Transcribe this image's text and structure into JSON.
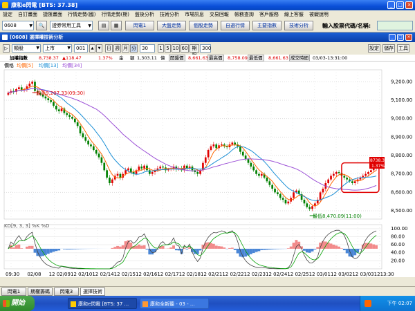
{
  "window": {
    "title": "康和e閃電 [BTS: 37.38]",
    "min": "_",
    "max": "□",
    "close": "×"
  },
  "menu": [
    "設定",
    "自訂畫面",
    "捷匯畫面",
    "行情走勢(國)",
    "行情走勢(期)",
    "盤後分析",
    "技術分析",
    "市場訊息",
    "交易回報",
    "帳務查詢",
    "客戶服務",
    "線上客服",
    "被蝦說明"
  ],
  "toolbar": {
    "code": "0608",
    "group": "證券常用工具",
    "buttons": [
      "閃電1",
      "大盤走勢",
      "個股走勢",
      "自選行情",
      "主要指數",
      "技術分析"
    ],
    "input_label": "輸入股票代碼/名稱:",
    "input_value": ""
  },
  "chart_window": {
    "title": "[0608] 選擇權技術分析",
    "btn_settings": "設定",
    "btn_save": "儲存",
    "btn_tool": "工具"
  },
  "subtool": {
    "category": "類股",
    "market": "上市",
    "code": "001",
    "period_buttons": [
      "日",
      "週",
      "月",
      "分"
    ],
    "minutes": "30",
    "count_buttons": [
      "1",
      "5",
      "10",
      "60",
      "期限"
    ],
    "bars": "300"
  },
  "info": {
    "name": "加權指數",
    "price": "8,738.37",
    "change": "▲118.47",
    "pct": "1.37%",
    "amount_label": "金",
    "amount": "額",
    "amount_value": "1,303.11",
    "unit": "億",
    "open_label": "開盤價",
    "open": "8,661.63",
    "high_label": "最高價",
    "high": "8,758.09",
    "low_label": "最低價",
    "low": "8,661.63",
    "time_label": "成交時間",
    "time": "03/03-13:31:00"
  },
  "price_legend": {
    "label": "價格",
    "ma1": "均價[5]",
    "ma2": "均價[13]",
    "ma3": "均價[34]"
  },
  "kd_legend": "KD[9, 3, 3] %K %D",
  "annotations": {
    "high": "最高9,207.33(09:30)",
    "low": "最低8,470.09(11:00)",
    "last_price": "8738.37",
    "last_pct": "1.37%"
  },
  "bottom_tabs": [
    "閃電1",
    "期權籌碼",
    "閃電3",
    "選擇技術"
  ],
  "taskbar": {
    "start": "開始",
    "tasks": [
      "康和e閃電 [BTS: 37 ...",
      "康和全新聽 - 03 - ..."
    ],
    "clock": "下午 02:07"
  },
  "colors": {
    "up": "#e00000",
    "down": "#008000",
    "ma5": "#ff6600",
    "ma13": "#1a8fd6",
    "ma34": "#9b4fd6",
    "k": "#404040",
    "d": "#00a000",
    "hist_pos": "#f28a8a",
    "hist_neg": "#4a86d6"
  },
  "chart_data": {
    "type": "candlestick",
    "title": "加權指數 30分K",
    "y_ticks": [
      9200,
      9100,
      9000,
      8900,
      8800,
      8700,
      8600,
      8500
    ],
    "ylim": [
      8455,
      9265
    ],
    "x_labels": [
      "09:30",
      "02/08",
      "12 02/09",
      "12 02/10",
      "12 02/14",
      "12 02/15",
      "12 02/16",
      "12 02/17",
      "12 02/18",
      "12 02/21",
      "12 02/22",
      "12 02/23",
      "12 02/24",
      "12 02/25",
      "12 03/01",
      "12 03/02",
      "12 03/03",
      "1213:30"
    ],
    "close": [
      9140,
      9150,
      9145,
      9160,
      9170,
      9155,
      9160,
      9175,
      9190,
      9200,
      9150,
      9140,
      9130,
      9120,
      9110,
      9100,
      9090,
      9070,
      9050,
      9040,
      9055,
      9030,
      9020,
      9010,
      9000,
      8980,
      8960,
      8920,
      8900,
      8880,
      8860,
      8850,
      8830,
      8810,
      8790,
      8760,
      8720,
      8680,
      8650,
      8670,
      8690,
      8700,
      8680,
      8700,
      8720,
      8730,
      8710,
      8700,
      8720,
      8740,
      8730,
      8745,
      8720,
      8700,
      8710,
      8720,
      8730,
      8740,
      8735,
      8720,
      8725,
      8730,
      8740,
      8725,
      8730,
      8720,
      8745,
      8730,
      8740,
      8720,
      8710,
      8700,
      8720,
      8760,
      8790,
      8830,
      8850,
      8860,
      8840,
      8855,
      8860,
      8850,
      8845,
      8860,
      8870,
      8860,
      8850,
      8820,
      8800,
      8780,
      8760,
      8740,
      8720,
      8700,
      8690,
      8700,
      8680,
      8660,
      8640,
      8620,
      8600,
      8590,
      8570,
      8560,
      8540,
      8550,
      8570,
      8600,
      8610,
      8590,
      8560,
      8540,
      8520,
      8510,
      8525,
      8540,
      8560,
      8600,
      8620,
      8650,
      8670,
      8690,
      8700,
      8710,
      8705,
      8690,
      8680,
      8670,
      8660,
      8650,
      8660,
      8670,
      8680,
      8690,
      8700,
      8710,
      8720,
      8730,
      8738
    ],
    "kd_ticks": [
      100,
      80,
      60,
      40,
      20
    ],
    "kd_ylim": [
      0,
      110
    ]
  }
}
